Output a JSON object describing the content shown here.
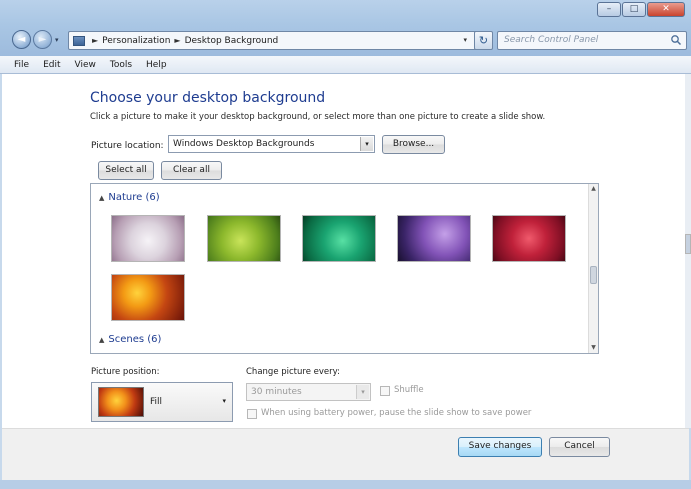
{
  "window": {
    "controls": {
      "minimize": "–",
      "maximize": "□",
      "close": "✕"
    }
  },
  "nav": {
    "back_glyph": "◄",
    "forward_glyph": "►",
    "dropdown_glyph": "▾",
    "refresh_glyph": "↻"
  },
  "address": {
    "separator": "►",
    "crumbs": [
      "Personalization",
      "Desktop Background"
    ],
    "dropdown_glyph": "▾"
  },
  "search": {
    "placeholder": "Search Control Panel"
  },
  "menu": {
    "items": [
      "File",
      "Edit",
      "View",
      "Tools",
      "Help"
    ]
  },
  "main": {
    "heading": "Choose your desktop background",
    "subtext": "Click a picture to make it your desktop background, or select more than one picture to create a slide show.",
    "location_label": "Picture location:",
    "location_value": "Windows Desktop Backgrounds",
    "browse_label": "Browse...",
    "select_all_label": "Select all",
    "clear_all_label": "Clear all"
  },
  "gallery": {
    "groups": [
      {
        "title": "Nature (6)"
      },
      {
        "title": "Scenes (6)"
      }
    ]
  },
  "settings": {
    "position_label": "Picture position:",
    "position_value": "Fill",
    "change_label": "Change picture every:",
    "interval_value": "30 minutes",
    "shuffle_label": "Shuffle",
    "battery_label": "When using battery power, pause the slide show to save power"
  },
  "footer": {
    "save_label": "Save changes",
    "cancel_label": "Cancel"
  },
  "colors": {
    "heading": "#1e3c90",
    "save_button_border": "#3c7fb1"
  }
}
